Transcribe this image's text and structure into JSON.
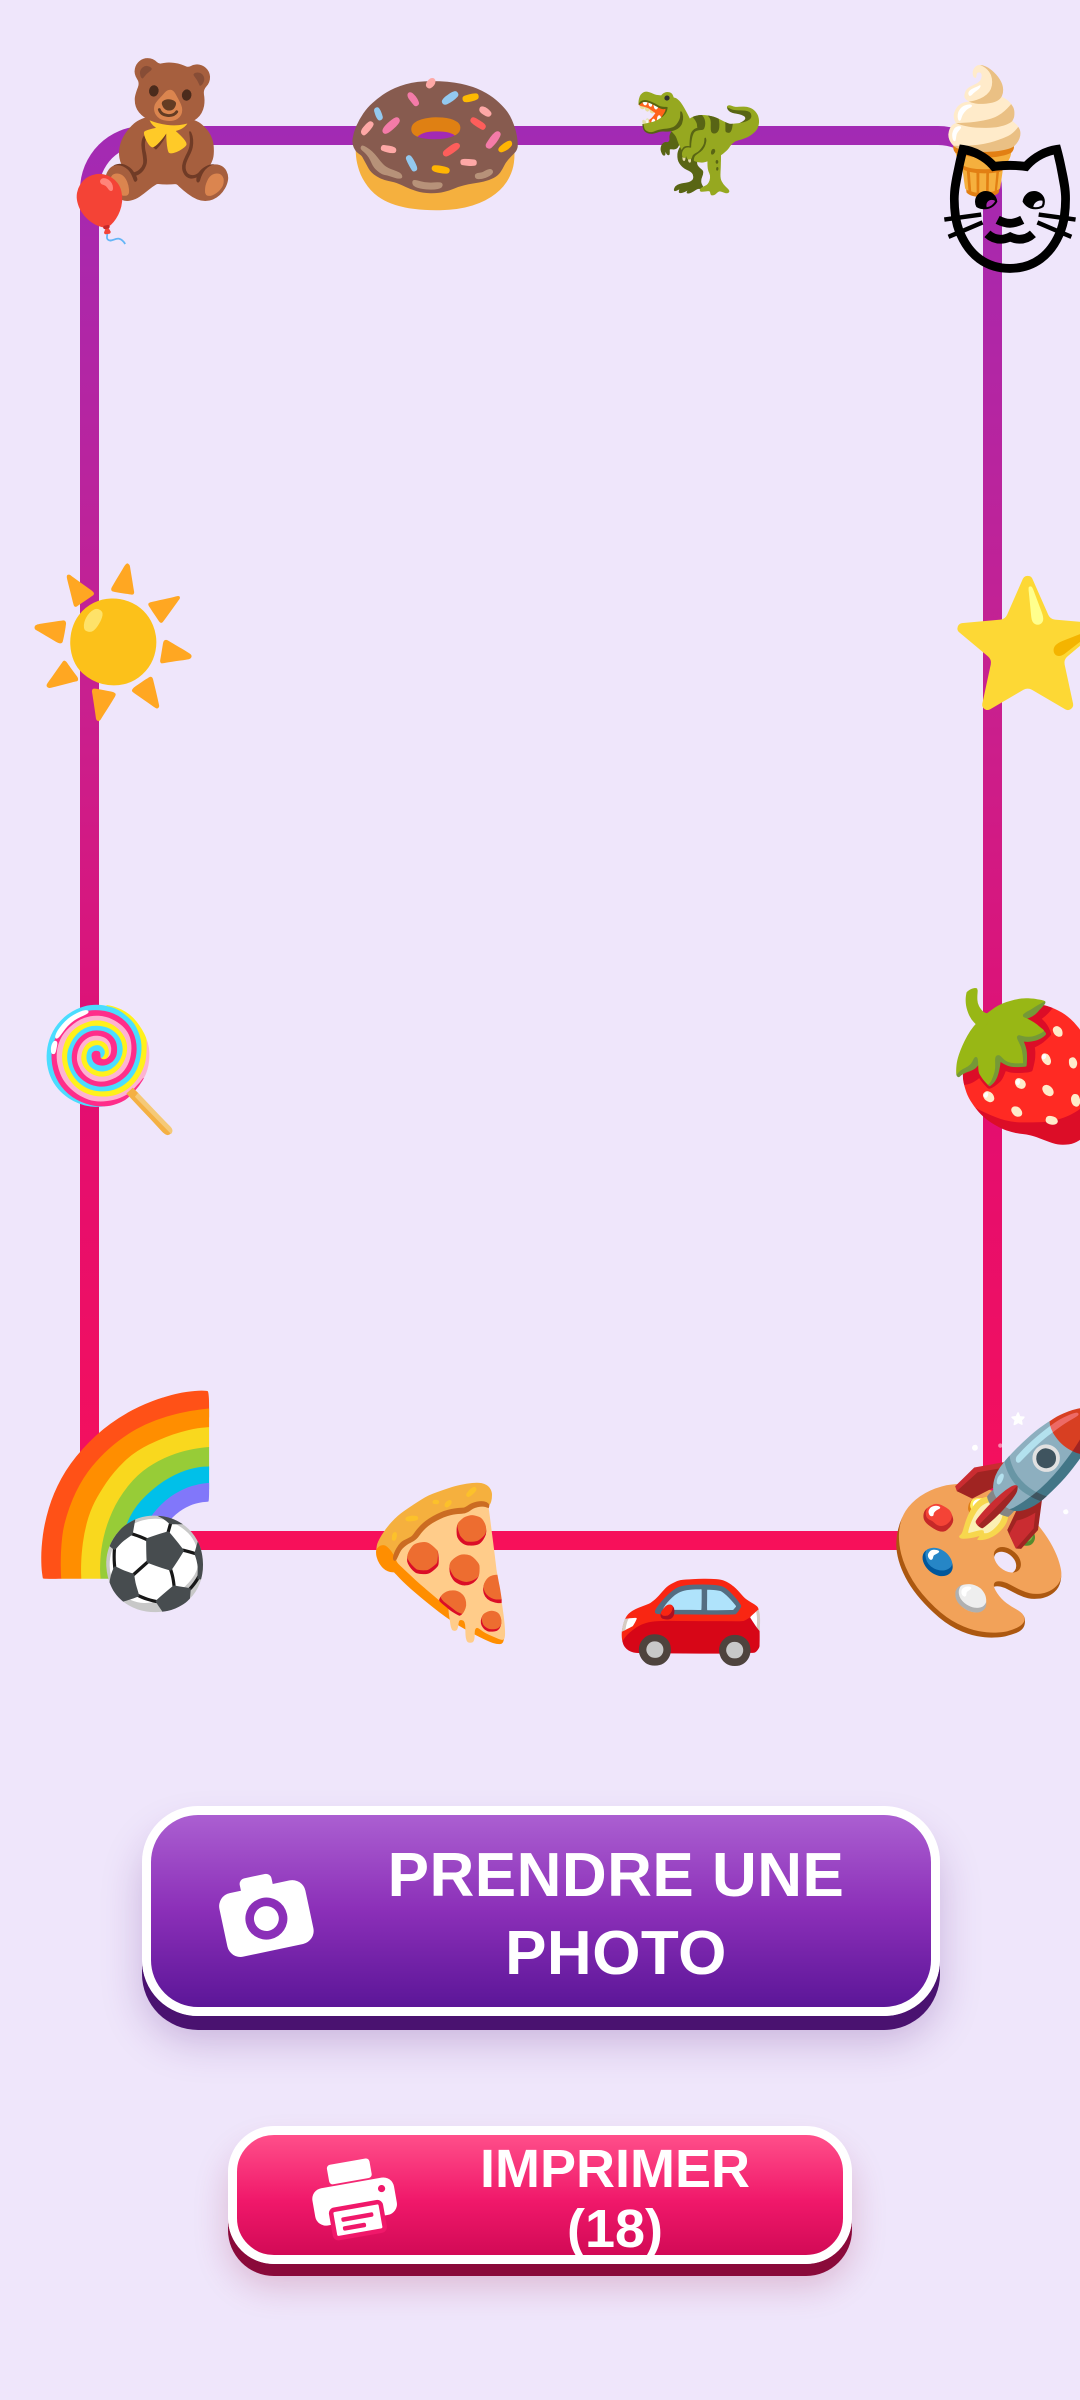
{
  "buttons": {
    "take_photo": {
      "label": "PRENDRE UNE\nPHOTO",
      "icon": "camera-icon"
    },
    "print": {
      "label": "IMPRIMER\n(18)",
      "icon": "printer-icon"
    }
  },
  "frame": {
    "stickers": [
      {
        "name": "teddy-bear",
        "glyph": "🧸"
      },
      {
        "name": "balloon",
        "glyph": "🎈"
      },
      {
        "name": "donut",
        "glyph": "🍩"
      },
      {
        "name": "t-rex",
        "glyph": "🦖"
      },
      {
        "name": "ice-cream",
        "glyph": "🍦"
      },
      {
        "name": "cat",
        "glyph": "🐱"
      },
      {
        "name": "sun",
        "glyph": "☀️"
      },
      {
        "name": "star",
        "glyph": "⭐"
      },
      {
        "name": "lollipop",
        "glyph": "🍭"
      },
      {
        "name": "strawberry",
        "glyph": "🍓"
      },
      {
        "name": "rainbow",
        "glyph": "🌈"
      },
      {
        "name": "soccer-ball",
        "glyph": "⚽"
      },
      {
        "name": "pizza",
        "glyph": "🍕"
      },
      {
        "name": "car",
        "glyph": "🚗"
      },
      {
        "name": "palette",
        "glyph": "🎨"
      },
      {
        "name": "rocket",
        "glyph": "🚀"
      }
    ],
    "gradient": [
      "#a22ab4",
      "#c8208f",
      "#e40e6f",
      "#f7105a"
    ]
  },
  "colors": {
    "background": "#efe6fb",
    "photo_button": "#8b2fb8",
    "print_button": "#f0186a"
  }
}
